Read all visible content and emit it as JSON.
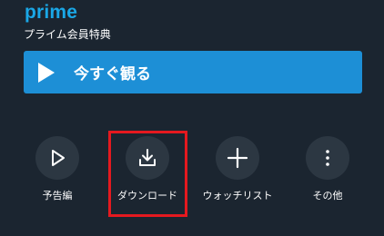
{
  "header": {
    "brand": "prime",
    "subtitle": "プライム会員特典"
  },
  "watch_button": {
    "label": "今すぐ観る"
  },
  "actions": [
    {
      "label": "予告編",
      "icon": "play-outline-icon"
    },
    {
      "label": "ダウンロード",
      "icon": "download-icon"
    },
    {
      "label": "ウォッチリスト",
      "icon": "plus-icon"
    },
    {
      "label": "その他",
      "icon": "more-vertical-icon"
    }
  ],
  "colors": {
    "background": "#1b2530",
    "brand": "#1aa7e6",
    "accent_button": "#1d8fd6",
    "icon_circle": "#2c3742",
    "highlight_box": "#e5191f"
  }
}
